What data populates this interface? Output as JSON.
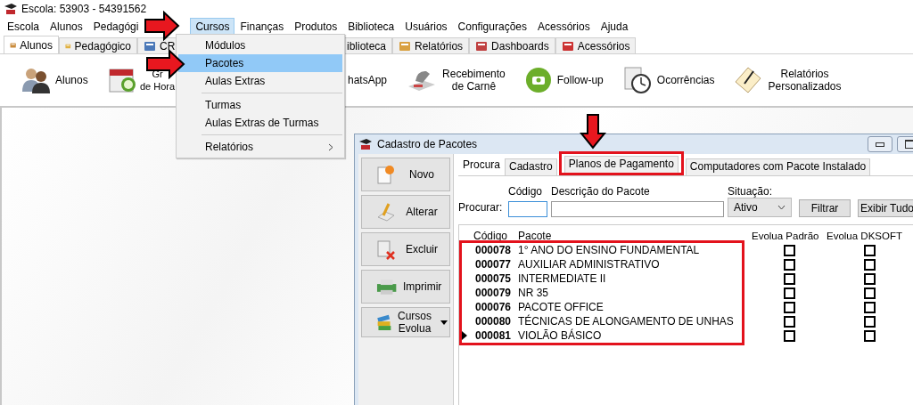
{
  "window": {
    "title": "Escola: 53903 - 54391562"
  },
  "menu_bar": [
    {
      "label": "Escola",
      "selected": false
    },
    {
      "label": "Alunos",
      "selected": false
    },
    {
      "label": "Pedagógi",
      "selected": false
    },
    {
      "label": "Cursos",
      "selected": true
    },
    {
      "label": "Finanças",
      "selected": false
    },
    {
      "label": "Produtos",
      "selected": false
    },
    {
      "label": "Biblioteca",
      "selected": false
    },
    {
      "label": "Usuários",
      "selected": false
    },
    {
      "label": "Configurações",
      "selected": false
    },
    {
      "label": "Acessórios",
      "selected": false
    },
    {
      "label": "Ajuda",
      "selected": false
    }
  ],
  "ribbon_tabs": [
    {
      "label": "Alunos",
      "selected": true
    },
    {
      "label": "Pedagógico",
      "selected": false
    },
    {
      "label": "CR",
      "selected": false
    },
    {
      "label": "iblioteca",
      "selected": false
    },
    {
      "label": "Relatórios",
      "selected": false
    },
    {
      "label": "Dashboards",
      "selected": false
    },
    {
      "label": "Acessórios",
      "selected": false
    }
  ],
  "ribbon_items": [
    {
      "lines": [
        "Alunos"
      ]
    },
    {
      "lines": [
        "Gr",
        "de Hora"
      ]
    },
    {
      "lines": [
        "hatsApp"
      ]
    },
    {
      "lines": [
        "Recebimento",
        "de Carnê"
      ]
    },
    {
      "lines": [
        "Follow-up"
      ]
    },
    {
      "lines": [
        "Ocorrências"
      ]
    },
    {
      "lines": [
        "Relatórios",
        "Personalizados"
      ]
    }
  ],
  "dropdown_menu": [
    {
      "kind": "item",
      "label": "Módulos",
      "selected": false
    },
    {
      "kind": "item",
      "label": "Pacotes",
      "selected": true
    },
    {
      "kind": "item",
      "label": "Aulas Extras",
      "selected": false
    },
    {
      "kind": "separator"
    },
    {
      "kind": "item",
      "label": "Turmas",
      "selected": false
    },
    {
      "kind": "item",
      "label": "Aulas Extras de Turmas",
      "selected": false
    },
    {
      "kind": "separator"
    },
    {
      "kind": "submenu",
      "label": "Relatórios",
      "selected": false
    }
  ],
  "dialog": {
    "title": "Cadastro de Pacotes",
    "side_buttons": [
      {
        "label": "Novo",
        "kind": "plain"
      },
      {
        "label": "Alterar",
        "kind": "plain"
      },
      {
        "label": "Excluir",
        "kind": "plain"
      },
      {
        "label": "Imprimir",
        "kind": "plain"
      },
      {
        "label": "Cursos Evolua",
        "kind": "split"
      }
    ],
    "tabs": [
      {
        "label": "Procura",
        "selected": true
      },
      {
        "label": "Cadastro",
        "selected": false
      },
      {
        "label": "Planos de Pagamento",
        "selected": false
      },
      {
        "label": "Computadores com Pacote Instalado",
        "selected": false
      }
    ],
    "search": {
      "label": "Procurar:",
      "code_label": "Código",
      "description_label": "Descrição do Pacote",
      "status_label": "Situação:",
      "status_value": "Ativo",
      "buttons": [
        "Filtrar",
        "Exibir Tudo"
      ]
    },
    "table": {
      "columns": [
        "Código",
        "Pacote",
        "Evolua Padrão",
        "Evolua DKSOFT"
      ],
      "rows": [
        {
          "code": "000078",
          "name": "1° ANO DO ENSINO FUNDAMENTAL",
          "evolua_padrao": false,
          "evolua_dksoft": false,
          "current": false
        },
        {
          "code": "000077",
          "name": "AUXILIAR ADMINISTRATIVO",
          "evolua_padrao": false,
          "evolua_dksoft": false,
          "current": false
        },
        {
          "code": "000075",
          "name": "INTERMEDIATE II",
          "evolua_padrao": false,
          "evolua_dksoft": false,
          "current": false
        },
        {
          "code": "000079",
          "name": "NR 35",
          "evolua_padrao": false,
          "evolua_dksoft": false,
          "current": false
        },
        {
          "code": "000076",
          "name": "PACOTE OFFICE",
          "evolua_padrao": false,
          "evolua_dksoft": false,
          "current": false
        },
        {
          "code": "000080",
          "name": "TÉCNICAS DE ALONGAMENTO DE UNHAS",
          "evolua_padrao": false,
          "evolua_dksoft": false,
          "current": false
        },
        {
          "code": "000081",
          "name": "VIOLÃO BÁSICO",
          "evolua_padrao": false,
          "evolua_dksoft": false,
          "current": true
        }
      ]
    }
  }
}
